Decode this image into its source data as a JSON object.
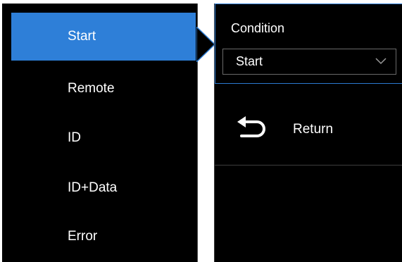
{
  "left_menu": {
    "items": [
      {
        "label": "Start",
        "selected": true
      },
      {
        "label": "Remote",
        "selected": false
      },
      {
        "label": "ID",
        "selected": false
      },
      {
        "label": "ID+Data",
        "selected": false
      },
      {
        "label": "Error",
        "selected": false
      }
    ]
  },
  "right_panel": {
    "condition": {
      "label": "Condition",
      "value": "Start"
    },
    "return": {
      "label": "Return"
    }
  },
  "colors": {
    "background": "#000000",
    "selection": "#2e7fd8",
    "focus_border": "#2b7ad1",
    "text": "#ffffff"
  },
  "icons": {
    "select": "chevron-down-icon",
    "return": "return-arrow-icon",
    "pointer": "pointer-arrow-icon"
  }
}
